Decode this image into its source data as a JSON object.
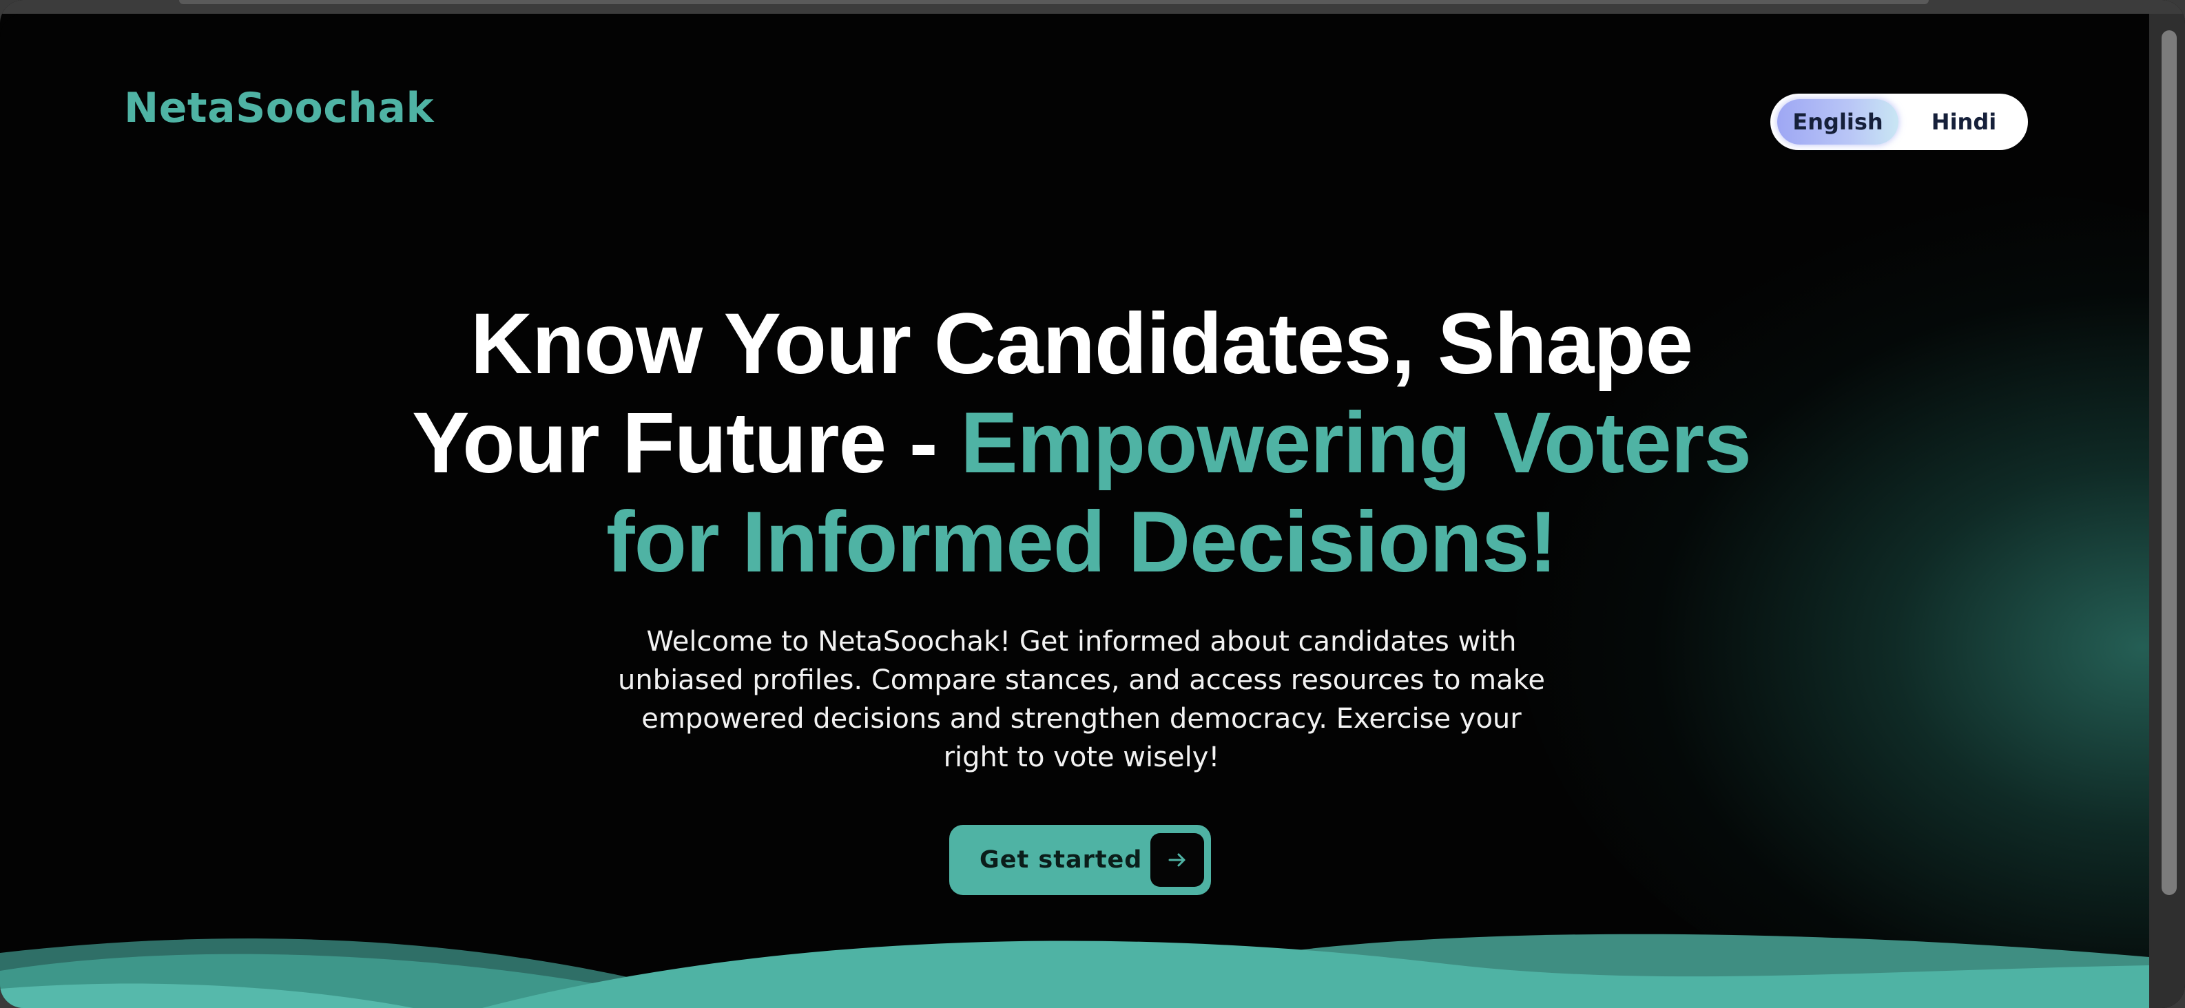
{
  "header": {
    "brand": "NetaSoochak",
    "languages": [
      "English",
      "Hindi"
    ],
    "selected_language": "English"
  },
  "hero": {
    "title_plain": "Know Your Candidates, Shape Your Future - ",
    "title_accent": "Empowering Voters for Informed Decisions!",
    "description": "Welcome to NetaSoochak! Get informed about candidates with unbiased profiles. Compare stances, and access resources to make empowered decisions and strengthen democracy. Exercise your right to vote wisely!",
    "cta_label": "Get started",
    "cta_icon": "arrow-right-icon"
  },
  "colors": {
    "accent": "#4fb3a4",
    "background": "#030303",
    "active_language_gradient": [
      "#9ea7f4",
      "#c9e6f4"
    ]
  }
}
